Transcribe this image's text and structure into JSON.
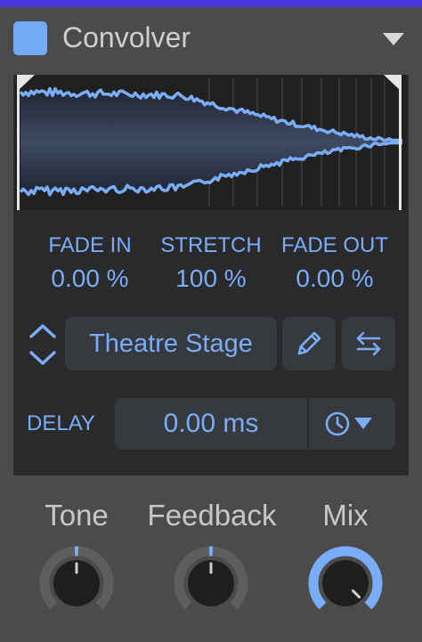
{
  "header": {
    "title": "Convolver",
    "swatch_color": "#74a9f5",
    "menu_icon": "triangle-down-icon"
  },
  "params": [
    {
      "label": "FADE IN",
      "value": "0.00 %"
    },
    {
      "label": "STRETCH",
      "value": "100 %"
    },
    {
      "label": "FADE OUT",
      "value": "0.00 %"
    }
  ],
  "preset": {
    "name": "Theatre Stage",
    "edit_icon": "pencil-icon",
    "swap_icon": "swap-arrows-icon",
    "nav_icon": "up-down-chevron-icon"
  },
  "delay": {
    "label": "DELAY",
    "value": "0.00 ms",
    "sync_icon": "clock-icon"
  },
  "knobs": [
    {
      "label": "Tone",
      "level": 0.5
    },
    {
      "label": "Feedback",
      "level": 0.5
    },
    {
      "label": "Mix",
      "level": 1.0
    }
  ],
  "colors": {
    "accent": "#79adf7",
    "panel": "#2a2a2c",
    "button": "#36393e",
    "top_bar": "#4a34e0"
  }
}
